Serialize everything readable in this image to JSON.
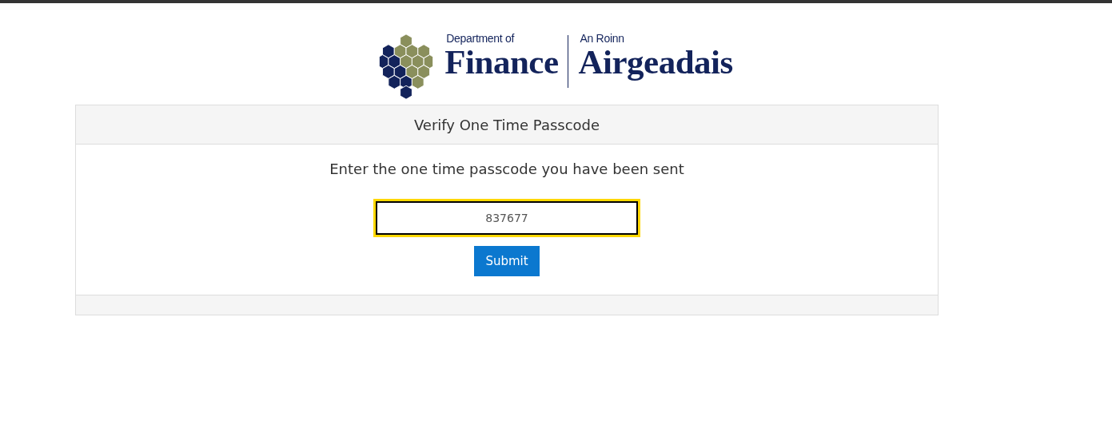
{
  "logo": {
    "department_en": "Department of",
    "name_en": "Finance",
    "department_ga": "An Roinn",
    "name_ga": "Airgeadais"
  },
  "panel": {
    "title": "Verify One Time Passcode",
    "instruction": "Enter the one time passcode you have been sent",
    "passcode_field": {
      "value": "837677",
      "focused": true
    },
    "submit_button": "Submit"
  }
}
